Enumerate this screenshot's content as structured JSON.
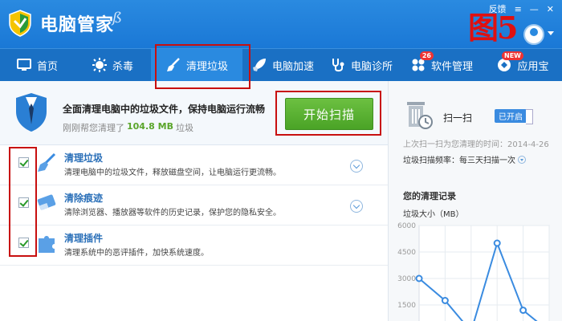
{
  "app": {
    "title": "电脑管家",
    "signature": "ß",
    "feedback": "反馈",
    "menu_icon": "≡",
    "minimize_icon": "—",
    "close_icon": "✕",
    "annotation": "图5"
  },
  "nav": [
    {
      "label": "首页",
      "icon": "monitor-icon"
    },
    {
      "label": "杀毒",
      "icon": "virus-shield-icon"
    },
    {
      "label": "清理垃圾",
      "icon": "broom-icon",
      "active": true
    },
    {
      "label": "电脑加速",
      "icon": "rocket-icon"
    },
    {
      "label": "电脑诊所",
      "icon": "stethoscope-icon"
    },
    {
      "label": "软件管理",
      "icon": "apps-icon",
      "badge": "26"
    },
    {
      "label": "应用宝",
      "icon": "store-icon",
      "badge": "NEW"
    }
  ],
  "promo": {
    "title": "全面清理电脑中的垃圾文件，保持电脑运行流畅",
    "sub_prefix": "刚刚帮您清理了",
    "sub_size": "104.8 MB",
    "sub_suffix": "垃圾",
    "scan_button": "开始扫描"
  },
  "items": [
    {
      "title": "清理垃圾",
      "desc": "清理电脑中的垃圾文件，释放磁盘空间，让电脑运行更流畅。",
      "checked": true,
      "icon": "broom-icon"
    },
    {
      "title": "清除痕迹",
      "desc": "清除浏览器、播放器等软件的历史记录，保护您的隐私安全。",
      "checked": true,
      "icon": "eraser-icon"
    },
    {
      "title": "清理插件",
      "desc": "清理系统中的恶评插件，加快系统速度。",
      "checked": true,
      "icon": "puzzle-icon"
    }
  ],
  "side": {
    "sweep_title": "扫一扫",
    "toggle_label": "已开启",
    "last_scan": "上次扫一扫为您清理的时间：2014-4-26",
    "freq_label": "垃圾扫描频率：每三天扫描一次",
    "history_title": "您的清理记录",
    "chart_ylabel": "垃圾大小（MB）"
  },
  "colors": {
    "titlebar": "#1a78d6",
    "navbar": "#1a70c4",
    "scan_button": "#4aa326",
    "annotation": "#c80f0f"
  },
  "chart_data": {
    "type": "line",
    "title": "",
    "ylabel": "垃圾大小（MB）",
    "yticks": [
      6000,
      4500,
      3000,
      1500
    ],
    "ylim": [
      0,
      6000
    ],
    "x": [
      1,
      2,
      3,
      4,
      5,
      6
    ],
    "values": [
      3000,
      1750,
      0,
      5000,
      1200,
      0
    ]
  }
}
